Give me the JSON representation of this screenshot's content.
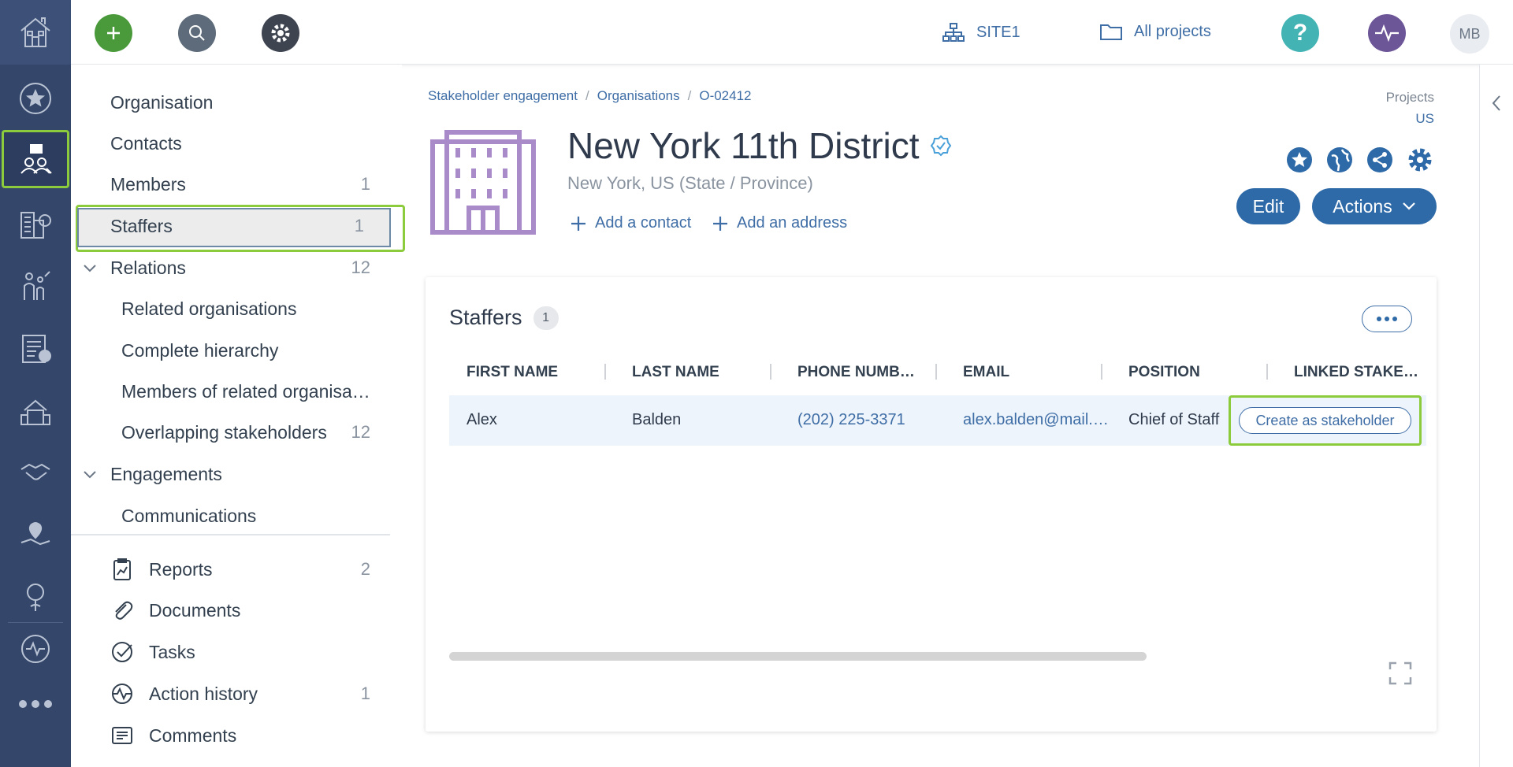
{
  "topbar": {
    "site_label": "SITE1",
    "projects_label": "All projects",
    "avatar_initials": "MB",
    "colors": {
      "add": "#4a9a3c",
      "search": "#5d6b7a",
      "settings": "#3e4450",
      "help": "#43b3b4",
      "activity": "#6d5698"
    }
  },
  "nav": {
    "organisation": "Organisation",
    "contacts": "Contacts",
    "members": "Members",
    "members_count": "1",
    "staffers": "Staffers",
    "staffers_count": "1",
    "relations": "Relations",
    "relations_count": "12",
    "related_orgs": "Related organisations",
    "complete_hierarchy": "Complete hierarchy",
    "members_related": "Members of related organisa…",
    "overlapping": "Overlapping stakeholders",
    "overlapping_count": "12",
    "engagements": "Engagements",
    "communications": "Communications",
    "reports": "Reports",
    "reports_count": "2",
    "documents": "Documents",
    "tasks": "Tasks",
    "action_history": "Action history",
    "action_history_count": "1",
    "comments": "Comments"
  },
  "breadcrumb": {
    "item1": "Stakeholder engagement",
    "item2": "Organisations",
    "item3": "O-02412",
    "sep": "/"
  },
  "projects": {
    "label": "Projects",
    "value": "US"
  },
  "org": {
    "title": "New York 11th District",
    "subtitle": "New York, US (State / Province)",
    "add_contact": "Add a contact",
    "add_address": "Add an address",
    "edit_label": "Edit",
    "actions_label": "Actions",
    "accent": "#2f6aa8",
    "icon_color": "#a98bc9"
  },
  "card": {
    "title": "Staffers",
    "count": "1",
    "columns": [
      "FIRST NAME",
      "LAST NAME",
      "PHONE NUMB…",
      "EMAIL",
      "POSITION",
      "LINKED STAKE…"
    ],
    "rows": [
      {
        "first_name": "Alex",
        "last_name": "Balden",
        "phone": "(202) 225-3371",
        "email": "alex.balden@mail.…",
        "position": "Chief of Staff",
        "linked": "Create as stakeholder"
      }
    ]
  }
}
